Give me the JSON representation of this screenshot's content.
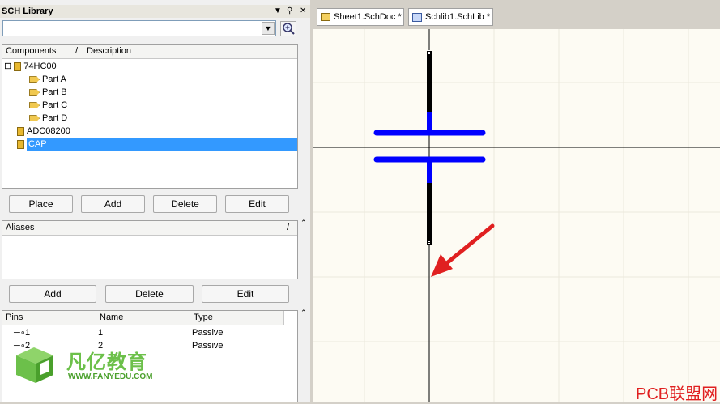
{
  "panel": {
    "title": "SCH Library",
    "title_controls": [
      "▼",
      "⚲",
      "✕"
    ],
    "filter_value": "",
    "components_header": "Components",
    "sort_glyph": "/",
    "description_header": "Description",
    "components": [
      {
        "label": "74HC00",
        "kind": "component",
        "expander": "⊟"
      },
      {
        "label": "Part A",
        "kind": "part"
      },
      {
        "label": "Part B",
        "kind": "part"
      },
      {
        "label": "Part C",
        "kind": "part"
      },
      {
        "label": "Part D",
        "kind": "part"
      },
      {
        "label": "ADC08200",
        "kind": "component"
      },
      {
        "label": "CAP",
        "kind": "component",
        "selected": true
      }
    ],
    "comp_buttons": {
      "place": "Place",
      "add": "Add",
      "delete": "Delete",
      "edit": "Edit"
    },
    "aliases_header": "Aliases",
    "alias_buttons": {
      "add": "Add",
      "delete": "Delete",
      "edit": "Edit"
    },
    "pins_headers": {
      "pins": "Pins",
      "name": "Name",
      "type": "Type"
    },
    "pins": [
      {
        "pin": "1",
        "name": "1",
        "type": "Passive"
      },
      {
        "pin": "2",
        "name": "2",
        "type": "Passive"
      }
    ]
  },
  "tabs": [
    {
      "label": "Sheet1.SchDoc *"
    },
    {
      "label": "Schlib1.SchLib *"
    }
  ],
  "watermark": {
    "brand_cn": "凡亿教育",
    "brand_url": "WWW.FANYEDU.COM",
    "corner_text": "PCB联盟网"
  },
  "colors": {
    "plate": "#0000ff",
    "lead": "#000000",
    "arrow": "#e02020",
    "selection": "#3399ff",
    "logo_green": "#6cc04a"
  }
}
